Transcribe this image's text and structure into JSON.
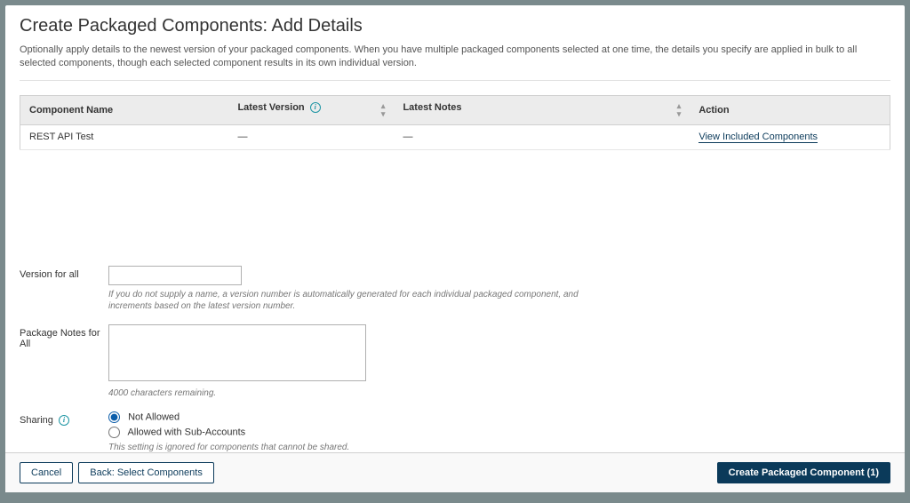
{
  "header": {
    "title": "Create Packaged Components: Add Details",
    "description": "Optionally apply details to the newest version of your packaged components. When you have multiple packaged components selected at one time, the details you specify are applied in bulk to all selected components, though each selected component results in its own individual version."
  },
  "table": {
    "columns": {
      "component_name": "Component Name",
      "latest_version": "Latest Version",
      "latest_notes": "Latest Notes",
      "action": "Action"
    },
    "rows": [
      {
        "component_name": "REST API Test",
        "latest_version": "—",
        "latest_notes": "—",
        "action": "View Included Components"
      }
    ]
  },
  "form": {
    "version": {
      "label": "Version for all",
      "value": "",
      "help": "If you do not supply a name, a version number is automatically generated for each individual packaged component, and increments based on the latest version number."
    },
    "notes": {
      "label": "Package Notes for All",
      "value": "",
      "counter": "4000 characters remaining."
    },
    "sharing": {
      "label": "Sharing",
      "options": {
        "not_allowed": "Not Allowed",
        "allowed_sub": "Allowed with Sub-Accounts"
      },
      "help": "This setting is ignored for components that cannot be shared."
    }
  },
  "footer": {
    "cancel": "Cancel",
    "back": "Back: Select Components",
    "create": "Create Packaged Component (1)"
  }
}
